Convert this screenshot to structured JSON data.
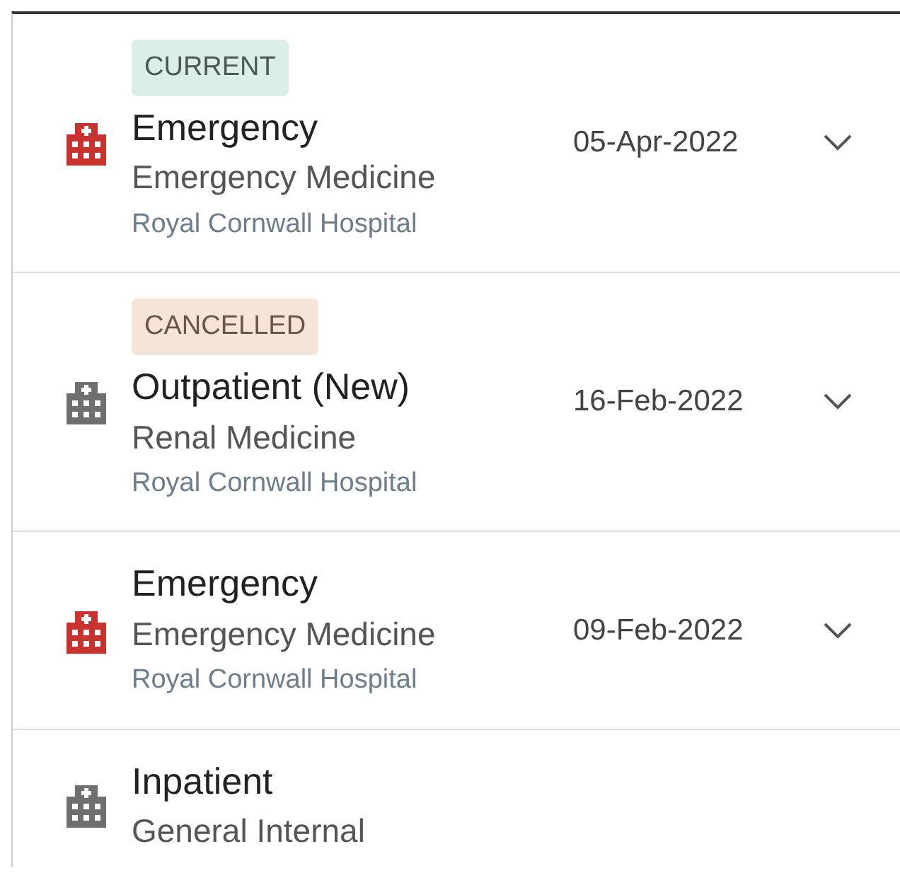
{
  "encounters": [
    {
      "status": {
        "label": "CURRENT",
        "kind": "current"
      },
      "color": "#c8322f",
      "type": "Emergency",
      "specialty": "Emergency Medicine",
      "location": "Royal Cornwall Hospital",
      "date": "05-Apr-2022"
    },
    {
      "status": {
        "label": "CANCELLED",
        "kind": "cancelled"
      },
      "color": "#6f6f6f",
      "type": "Outpatient (New)",
      "specialty": "Renal Medicine",
      "location": "Royal Cornwall Hospital",
      "date": "16-Feb-2022"
    },
    {
      "color": "#c8322f",
      "type": "Emergency",
      "specialty": "Emergency Medicine",
      "location": "Royal Cornwall Hospital",
      "date": "09-Feb-2022"
    },
    {
      "color": "#6f6f6f",
      "type": "Inpatient",
      "specialty": "General Internal"
    }
  ]
}
